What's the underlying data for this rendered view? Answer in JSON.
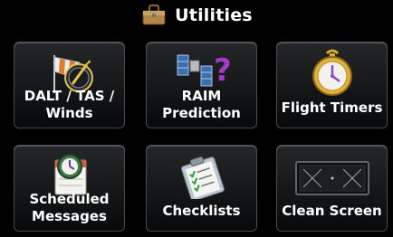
{
  "header": {
    "title": "Utilities",
    "title_icon": "toolbox-icon"
  },
  "buttons": [
    {
      "label_lines": [
        "DALT / TAS /",
        "Winds"
      ],
      "icon": "windsock-calculator-icon"
    },
    {
      "label_lines": [
        "RAIM",
        "Prediction"
      ],
      "icon": "satellite-question-icon"
    },
    {
      "label_lines": [
        "Flight Timers"
      ],
      "icon": "stopwatch-icon"
    },
    {
      "label_lines": [
        "Scheduled",
        "Messages"
      ],
      "icon": "clock-calendar-icon"
    },
    {
      "label_lines": [
        "Checklists"
      ],
      "icon": "clipboard-checklist-icon"
    },
    {
      "label_lines": [
        "Clean Screen"
      ],
      "icon": "display-screen-icon"
    }
  ],
  "colors": {
    "background": "#000000",
    "tile_border": "#4a4c4e",
    "text": "#ffffff"
  }
}
